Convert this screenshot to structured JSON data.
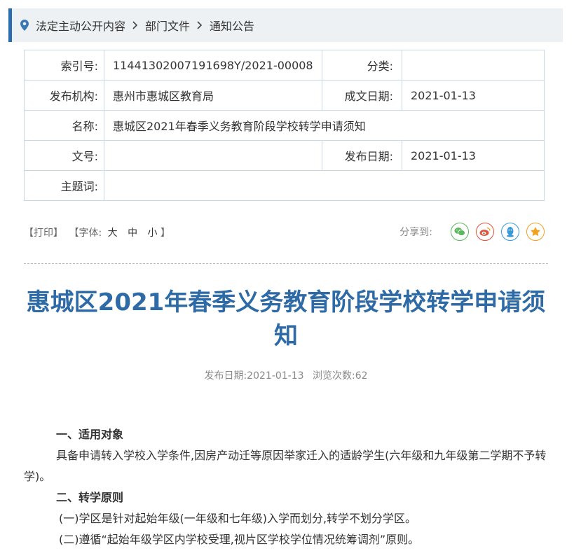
{
  "breadcrumb": {
    "items": [
      "法定主动公开内容",
      "部门文件",
      "通知公告"
    ],
    "separator": ">"
  },
  "meta": {
    "index_label": "索引号:",
    "index_value": "11441302007191698Y/2021-00008",
    "category_label": "分类:",
    "category_value": "",
    "org_label": "发布机构:",
    "org_value": "惠州市惠城区教育局",
    "created_label": "成文日期:",
    "created_value": "2021-01-13",
    "name_label": "名称:",
    "name_value": "惠城区2021年春季义务教育阶段学校转学申请须知",
    "docno_label": "文号:",
    "docno_value": "",
    "publish_label": "发布日期:",
    "publish_value": "2021-01-13",
    "subject_label": "主题词:",
    "subject_value": ""
  },
  "tools": {
    "print": "【打印】",
    "font_prefix": "【字体:",
    "font_large": "大",
    "font_medium": "中",
    "font_small": "小",
    "font_suffix": "】",
    "share_label": "分享到:"
  },
  "share_icons": [
    {
      "name": "wechat-icon",
      "color": "#5cb85c"
    },
    {
      "name": "weibo-icon",
      "color": "#e0533c"
    },
    {
      "name": "qq-icon",
      "color": "#3a9ad9"
    },
    {
      "name": "qzone-icon",
      "color": "#f0a21c"
    }
  ],
  "article": {
    "title": "惠城区2021年春季义务教育阶段学校转学申请须知",
    "pub_date_text": "发布日期:2021-01-13",
    "views_text": "浏览次数:62",
    "sections": [
      {
        "type": "h",
        "text": "一、适用对象"
      },
      {
        "type": "ind",
        "text": "具备申请转入学校入学条件,因房产动迁等原因举家迁入的适龄学生(六年级和九年级第二学期不予转学)。"
      },
      {
        "type": "h",
        "text": "二、转学原则"
      },
      {
        "type": "item",
        "text": "(一)学区是针对起始年级(一年级和七年级)入学而划分,转学不划分学区。"
      },
      {
        "type": "item",
        "text": "(二)遵循“起始年级学区内学校受理,视片区学校学位情况统筹调剂”原则。"
      }
    ]
  },
  "colors": {
    "accent": "#2b6cb0",
    "title": "#2d6aa6"
  }
}
